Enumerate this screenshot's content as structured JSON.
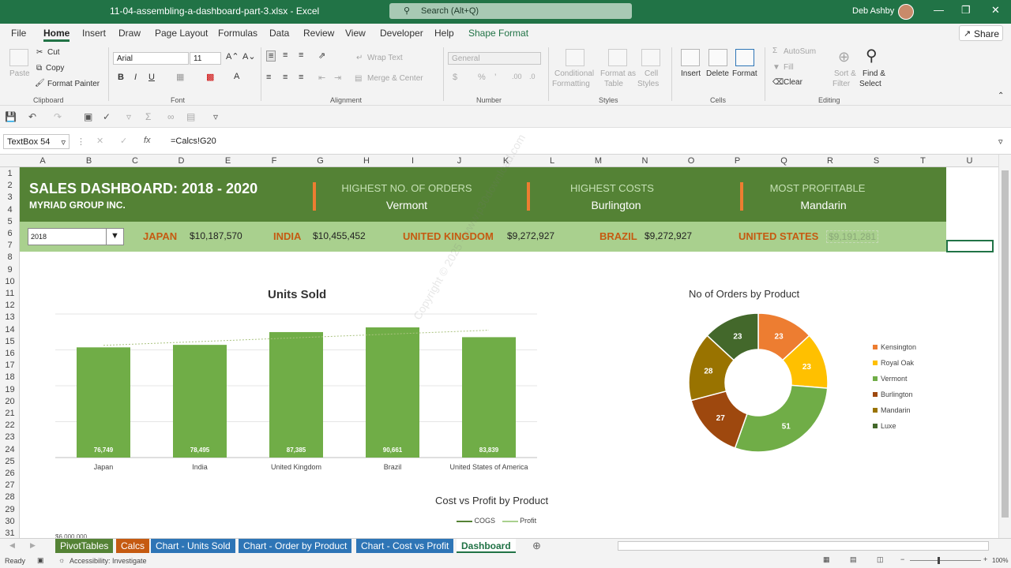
{
  "titlebar": {
    "filename": "11-04-assembling-a-dashboard-part-3.xlsx  -  Excel",
    "search": "Search (Alt+Q)",
    "user": "Deb Ashby"
  },
  "menu": {
    "items": [
      "File",
      "Home",
      "Insert",
      "Draw",
      "Page Layout",
      "Formulas",
      "Data",
      "Review",
      "View",
      "Developer",
      "Help",
      "Shape Format"
    ],
    "share": "Share"
  },
  "ribbon": {
    "clipboard": {
      "paste": "Paste",
      "cut": "Cut",
      "copy": "Copy",
      "format_painter": "Format Painter",
      "label": "Clipboard"
    },
    "font": {
      "name": "Arial",
      "size": "11",
      "label": "Font"
    },
    "alignment": {
      "wrap": "Wrap Text",
      "merge": "Merge & Center",
      "label": "Alignment"
    },
    "number": {
      "format": "General",
      "label": "Number"
    },
    "styles": {
      "conditional": "Conditional",
      "conditional2": "Formatting",
      "format_as": "Format as",
      "format_as2": "Table",
      "cell": "Cell",
      "cell2": "Styles",
      "label": "Styles"
    },
    "cells": {
      "insert": "Insert",
      "delete": "Delete",
      "format": "Format",
      "label": "Cells"
    },
    "editing": {
      "autosum": "AutoSum",
      "fill": "Fill",
      "clear": "Clear",
      "sort": "Sort &",
      "sort2": "Filter",
      "find": "Find &",
      "find2": "Select",
      "label": "Editing"
    }
  },
  "formula_bar": {
    "name_box": "TextBox 54",
    "fx": "fx",
    "formula": "=Calcs!G20"
  },
  "columns": [
    "A",
    "B",
    "C",
    "D",
    "E",
    "F",
    "G",
    "H",
    "I",
    "J",
    "K",
    "L",
    "M",
    "N",
    "O",
    "P",
    "Q",
    "R",
    "S",
    "T",
    "U"
  ],
  "rows": [
    "1",
    "2",
    "3",
    "4",
    "5",
    "6",
    "7",
    "8",
    "9",
    "10",
    "11",
    "12",
    "13",
    "14",
    "15",
    "16",
    "17",
    "18",
    "19",
    "20",
    "21",
    "22",
    "23",
    "24",
    "25",
    "26",
    "27",
    "28",
    "29",
    "30",
    "31"
  ],
  "dashboard": {
    "title": "SALES DASHBOARD: 2018 - 2020",
    "subtitle": "MYRIAD GROUP INC.",
    "kpis": [
      {
        "label": "HIGHEST NO. OF ORDERS",
        "value": "Vermont"
      },
      {
        "label": "HIGHEST COSTS",
        "value": "Burlington"
      },
      {
        "label": "MOST PROFITABLE",
        "value": "Mandarin"
      }
    ],
    "year": "2018",
    "countries": [
      {
        "name": "JAPAN",
        "value": "$10,187,570"
      },
      {
        "name": "INDIA",
        "value": "$10,455,452"
      },
      {
        "name": "UNITED KINGDOM",
        "value": "$9,272,927"
      },
      {
        "name": "BRAZIL",
        "value": "$9,272,927"
      },
      {
        "name": "UNITED STATES",
        "value": "$9,191,281"
      }
    ]
  },
  "chart_data": [
    {
      "type": "bar",
      "title": "Units Sold",
      "categories": [
        "Japan",
        "India",
        "United Kingdom",
        "Brazil",
        "United States of America"
      ],
      "values": [
        76749,
        78495,
        87385,
        90661,
        83839
      ],
      "labels": [
        "76,749",
        "78,495",
        "87,385",
        "90,661",
        "83,839"
      ],
      "color": "#70ad47",
      "trendline": true
    },
    {
      "type": "pie",
      "title": "No of Orders by Product",
      "categories": [
        "Kensington",
        "Royal Oak",
        "Vermont",
        "Burlington",
        "Mandarin",
        "Luxe"
      ],
      "values": [
        23,
        23,
        51,
        27,
        28,
        23
      ],
      "colors": [
        "#ed7d31",
        "#ffc000",
        "#70ad47",
        "#9e480e",
        "#997300",
        "#43682b"
      ]
    },
    {
      "type": "line",
      "title": "Cost vs Profit by Product",
      "series": [
        {
          "name": "COGS",
          "color": "#548235"
        },
        {
          "name": "Profit",
          "color": "#a9d08e"
        }
      ],
      "ytick_visible": "$6,000,000"
    }
  ],
  "tabs": [
    {
      "label": "PivotTables",
      "color": "#548235"
    },
    {
      "label": "Calcs",
      "color": "#c55a11"
    },
    {
      "label": "Chart - Units Sold",
      "color": "#2e75b6"
    },
    {
      "label": "Chart - Order by Product",
      "color": "#2e75b6"
    },
    {
      "label": "Chart - Cost vs Profit",
      "color": "#2e75b6"
    },
    {
      "label": "Dashboard",
      "color": "#ffffff"
    }
  ],
  "status": {
    "ready": "Ready",
    "accessibility": "Accessibility: Investigate",
    "zoom": "100%"
  },
  "watermark": "Copyright © 2025 - www.p30download.com"
}
